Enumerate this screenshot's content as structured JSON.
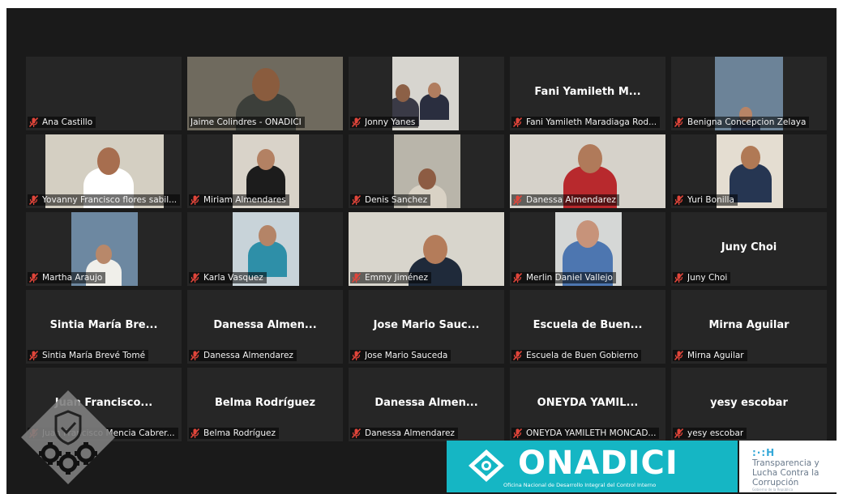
{
  "participants": [
    {
      "label": "Ana Castillo",
      "display_name": ""
    },
    {
      "label": "Jaime Colindres - ONADICI",
      "display_name": "",
      "active_speaker": true
    },
    {
      "label": "Jonny Yanes",
      "display_name": ""
    },
    {
      "label": "Fani Yamileth Maradiaga Rod...",
      "display_name": "Fani Yamileth M..."
    },
    {
      "label": "Benigna Concepcion Zelaya",
      "display_name": ""
    },
    {
      "label": "Yovanny Francisco flores sabil...",
      "display_name": ""
    },
    {
      "label": "Miriam Almendares",
      "display_name": ""
    },
    {
      "label": "Denis Sanchez",
      "display_name": ""
    },
    {
      "label": "Danessa Almendarez",
      "display_name": ""
    },
    {
      "label": "Yuri Bonilla",
      "display_name": ""
    },
    {
      "label": "Martha Araujo",
      "display_name": ""
    },
    {
      "label": "Karla Vasquez",
      "display_name": ""
    },
    {
      "label": "Emmy Jiménez",
      "display_name": ""
    },
    {
      "label": "Merlin Daniel Vallejo",
      "display_name": ""
    },
    {
      "label": "Juny Choi",
      "display_name": "Juny Choi"
    },
    {
      "label": "Sintia María Brevé Tomé",
      "display_name": "Sintia María Bre..."
    },
    {
      "label": "Danessa Almendarez",
      "display_name": "Danessa Almen..."
    },
    {
      "label": "Jose Mario Sauceda",
      "display_name": "Jose Mario Sauc..."
    },
    {
      "label": "Escuela de Buen Gobierno",
      "display_name": "Escuela de Buen..."
    },
    {
      "label": "Mirna Aguilar",
      "display_name": "Mirna Aguilar"
    },
    {
      "label": "Juan Francisco Mencia Cabrer...",
      "display_name": "Juan Francisco..."
    },
    {
      "label": "Belma Rodríguez",
      "display_name": "Belma Rodríguez"
    },
    {
      "label": "Danessa Almendarez",
      "display_name": "Danessa Almen..."
    },
    {
      "label": "ONEYDA YAMILETH MONCAD...",
      "display_name": "ONEYDA YAMIL..."
    },
    {
      "label": "yesy escobar",
      "display_name": "yesy escobar"
    }
  ],
  "branding": {
    "onadici_wordmark": "ONADICI",
    "onadici_subtitle": "Oficina Nacional de Desarrollo Integral del Control Interno",
    "transparencia_mark": ":·:H",
    "transparencia_text": "Transparencia y\nLucha Contra la\nCorrupción",
    "transparencia_small": "Gobierno de la República"
  },
  "colors": {
    "speaker_border": "#b6dd4a",
    "muted_mic": "#e0453a",
    "onadici_teal": "#15b6c4",
    "tile_bg": "#262626"
  }
}
